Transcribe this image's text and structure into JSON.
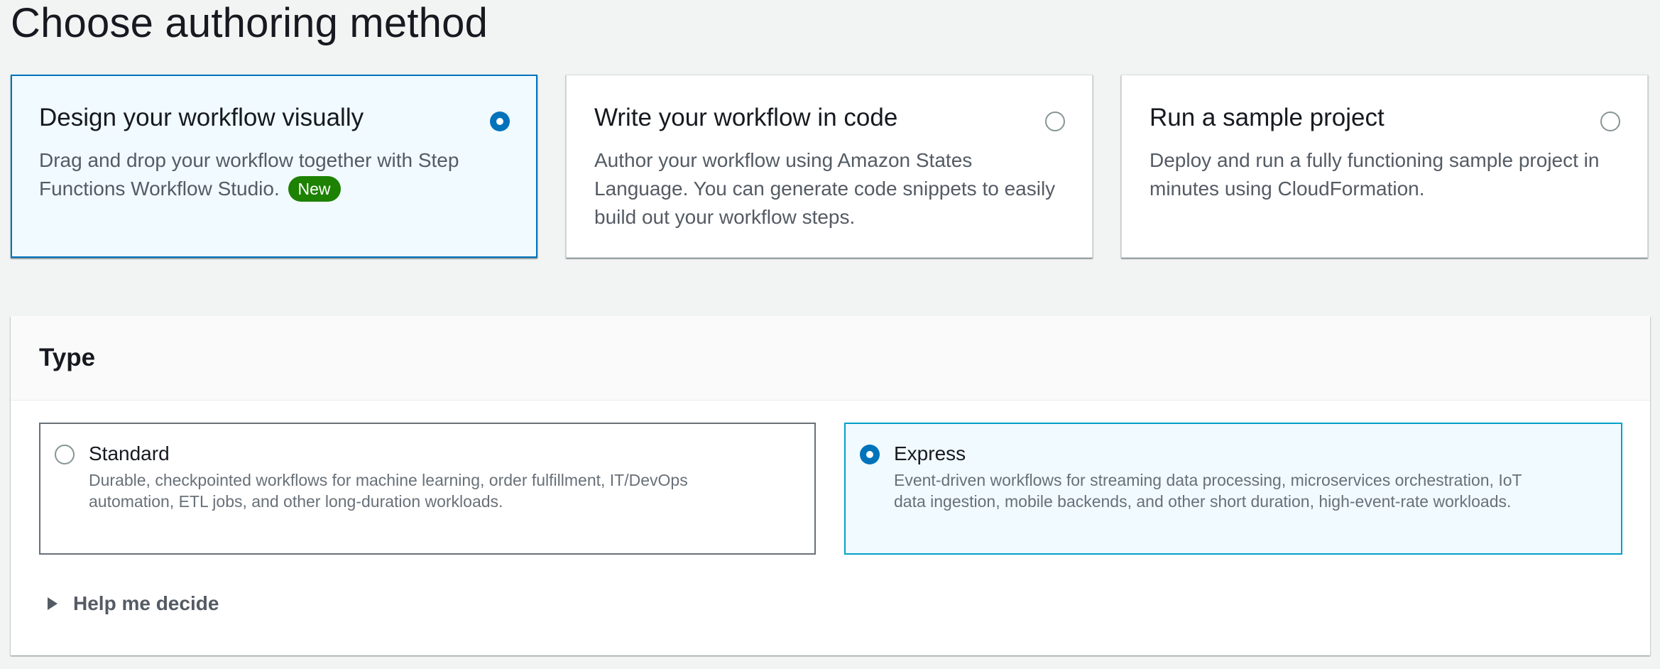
{
  "page": {
    "title": "Choose authoring method"
  },
  "authoring_methods": [
    {
      "title": "Design your workflow visually",
      "description": "Drag and drop your workflow together with Step Functions Workflow Studio.",
      "badge": "New",
      "selected": true
    },
    {
      "title": "Write your workflow in code",
      "description": "Author your workflow using Amazon States Language. You can generate code snippets to easily build out your workflow steps.",
      "selected": false
    },
    {
      "title": "Run a sample project",
      "description": "Deploy and run a fully functioning sample project in minutes using CloudFormation.",
      "selected": false
    }
  ],
  "type_section": {
    "heading": "Type",
    "options": [
      {
        "title": "Standard",
        "description": "Durable, checkpointed workflows for machine learning, order fulfillment, IT/DevOps automation, ETL jobs, and other long-duration workloads.",
        "selected": false
      },
      {
        "title": "Express",
        "description": "Event-driven workflows for streaming data processing, microservices orchestration, IoT data ingestion, mobile backends, and other short duration, high-event-rate workloads.",
        "selected": true
      }
    ],
    "help_toggle": {
      "label": "Help me decide",
      "icon": "caret-right-icon",
      "expanded": false
    }
  },
  "colors": {
    "accent": "#0073bb",
    "badge_green": "#1d8102",
    "selected_bg": "#f1faff",
    "express_border": "#00a1c9"
  }
}
